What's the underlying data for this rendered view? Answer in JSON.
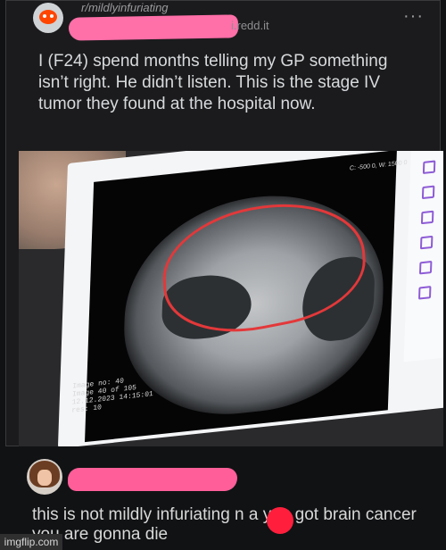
{
  "header": {
    "subreddit": "r/mildlyinfuriating",
    "domain": "i.redd.it",
    "menu_icon": "ellipsis-icon"
  },
  "post": {
    "title": "I (F24) spend months telling my GP something isn’t right. He didn’t listen. This is the stage IV tumor they found at the hospital now."
  },
  "ct_screen": {
    "ui_label": "C: -500 0, W: 1500 0",
    "meta": "Image no: 40\nImage 40 of 105\n12.12.2023 14:15:01\nres: 10"
  },
  "comment": {
    "text": "this is not mildly infuriating  n   a you got brain cancer you are gonna die"
  },
  "watermark": "imgflip.com",
  "colors": {
    "background": "#111214",
    "card": "#1b1b1d",
    "text": "#d7dadc",
    "accent_redaction": "#ff6fa8",
    "tumor_outline": "#e3383a",
    "dot": "#ff1f3d"
  }
}
